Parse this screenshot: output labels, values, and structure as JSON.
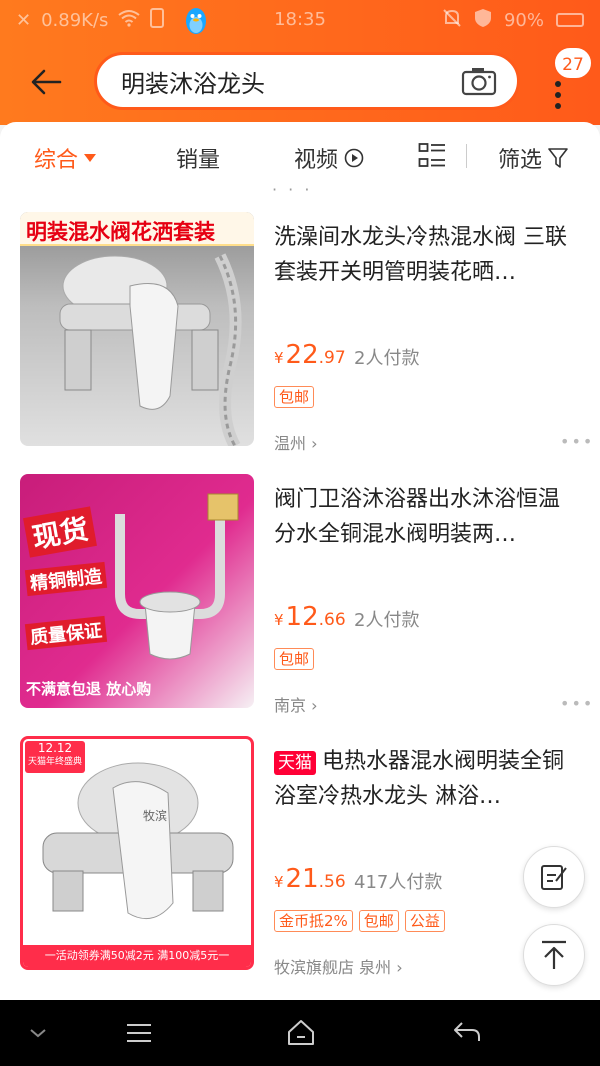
{
  "status_bar": {
    "speed": "0.89K/s",
    "time": "18:35",
    "battery": "90%"
  },
  "search": {
    "query": "明装沐浴龙头",
    "badge_count": "27"
  },
  "tabs": {
    "all": "综合",
    "sales": "销量",
    "video": "视频",
    "filter": "筛选"
  },
  "products": [
    {
      "image_text": "明装混水阀花洒套装",
      "title": "洗澡间水龙头冷热混水阀 三联套装开关明管明装花晒…",
      "price_int": "22",
      "price_dec": ".97",
      "sales": "2人付款",
      "tags": [
        "包邮"
      ],
      "location": "温州"
    },
    {
      "image_text_1": "现货",
      "image_text_2": "精铜制造",
      "image_text_3": "质量保证",
      "image_text_4": "不满意包退 放心购",
      "title": "阀门卫浴沐浴器出水沐浴恒温分水全铜混水阀明装两…",
      "price_int": "12",
      "price_dec": ".66",
      "sales": "2人付款",
      "tags": [
        "包邮"
      ],
      "location": "南京"
    },
    {
      "image_badge": "12.12",
      "image_badge_sub": "天猫年终盛典",
      "image_brand": "牧滨",
      "image_footer": "一活动领券满50减2元 满100减5元一",
      "tmall_label": "天猫",
      "title": "电热水器混水阀明装全铜浴室冷热水龙头 淋浴…",
      "price_int": "21",
      "price_dec": ".56",
      "sales": "417人付款",
      "tags": [
        "金币抵2%",
        "包邮",
        "公益"
      ],
      "location": "牧滨旗舰店 泉州"
    }
  ],
  "price_symbol": "¥",
  "colors": {
    "accent": "#ff5a1a",
    "tmall": "#ff0036"
  }
}
